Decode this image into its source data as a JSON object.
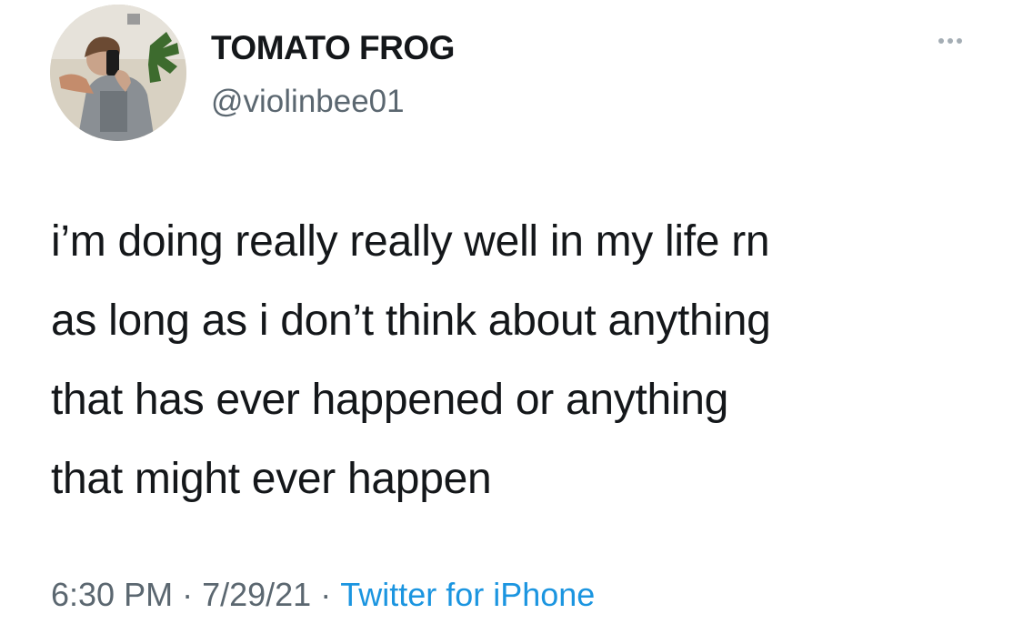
{
  "author": {
    "display_name": "TOMATO FROG",
    "handle": "@violinbee01",
    "avatar_icon": "user-photo-avatar"
  },
  "more_icon": "more-horizontal-icon",
  "tweet": {
    "lines": [
      "i’m doing really really well in my life rn",
      "as long as i don’t think about anything",
      "that has ever happened or anything",
      "that might ever happen"
    ]
  },
  "meta": {
    "time": "6:30 PM",
    "separator": "·",
    "date": "7/29/21",
    "source": "Twitter for iPhone"
  },
  "colors": {
    "text": "#14171a",
    "secondary": "#5b6770",
    "link": "#1b95e0",
    "background": "#ffffff"
  }
}
